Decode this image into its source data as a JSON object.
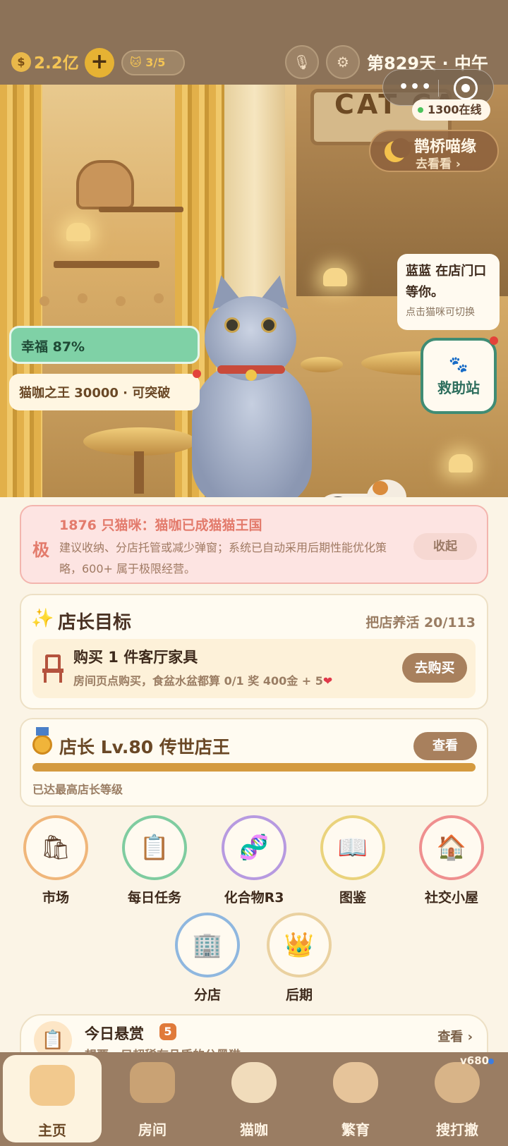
{
  "topbar": {
    "coins": "2.2亿",
    "add_label": "+",
    "cat_capacity": "3/5",
    "day_time": "第829天 · 中午",
    "capsule_more": "•••"
  },
  "scene": {
    "sign_text": "CAT CA",
    "online": "1300在线",
    "magpie": {
      "title": "鹊桥喵缘",
      "sub": "去看看 ›"
    },
    "speech": {
      "main": "蓝蓝 在店门口等你。",
      "hint": "点击猫咪可切换"
    },
    "rescue": {
      "icon": "🐾",
      "label": "救助站"
    },
    "happiness": "幸福 87%",
    "king": "猫咖之王 30000 · 可突破"
  },
  "warning": {
    "mark": "极",
    "title": "1876 只猫咪：猫咖已成猫猫王国",
    "body": "建议收纳、分店托管或减少弹窗；系统已自动采用后期性能优化策略，600+ 属于极限经营。",
    "collapse_label": "收起"
  },
  "goal": {
    "icon": "✨",
    "title": "店长目标",
    "progress_text": "把店养活  20/113",
    "task_title": "购买 1 件客厅家具",
    "task_desc": "房间页点购买，食盆水盆都算  0/1  奖 400金 + 5",
    "task_heart": "❤",
    "buy_label": "去购买"
  },
  "level": {
    "title": "店长 Lv.80  传世店王",
    "view_label": "查看",
    "progress": 1.0,
    "note": "已达最高店长等级"
  },
  "features": [
    {
      "label": "市场",
      "icon": "shopping-bag-icon",
      "glyph": "🛍",
      "color": "#f0b67a"
    },
    {
      "label": "每日任务",
      "icon": "clipboard-icon",
      "glyph": "📋",
      "color": "#7fcca0"
    },
    {
      "label": "化合物R3",
      "icon": "dna-icon",
      "glyph": "🧬",
      "color": "#b79ae0"
    },
    {
      "label": "图鉴",
      "icon": "book-icon",
      "glyph": "📖",
      "color": "#ead37c"
    },
    {
      "label": "社交小屋",
      "icon": "house-icon",
      "glyph": "🏠",
      "color": "#ef8f8f"
    },
    {
      "label": "分店",
      "icon": "building-icon",
      "glyph": "🏢",
      "color": "#8fb7df"
    },
    {
      "label": "后期",
      "icon": "crown-icon",
      "glyph": "👑",
      "color": "#ead1a0"
    }
  ],
  "bounty": {
    "icon": "📋",
    "title": "今日悬赏",
    "count": "5",
    "desc": "想要一只超稀有品质的公黑猫",
    "link": "查看 ›"
  },
  "nav": [
    {
      "label": "主页",
      "icon": "home-icon",
      "active": true
    },
    {
      "label": "房间",
      "icon": "room-icon",
      "active": false
    },
    {
      "label": "猫咖",
      "icon": "cat-cafe-icon",
      "active": false
    },
    {
      "label": "繁育",
      "icon": "breeding-icon",
      "active": false
    },
    {
      "label": "搜打撤",
      "icon": "search-map-icon",
      "active": false
    }
  ],
  "version": "v680"
}
